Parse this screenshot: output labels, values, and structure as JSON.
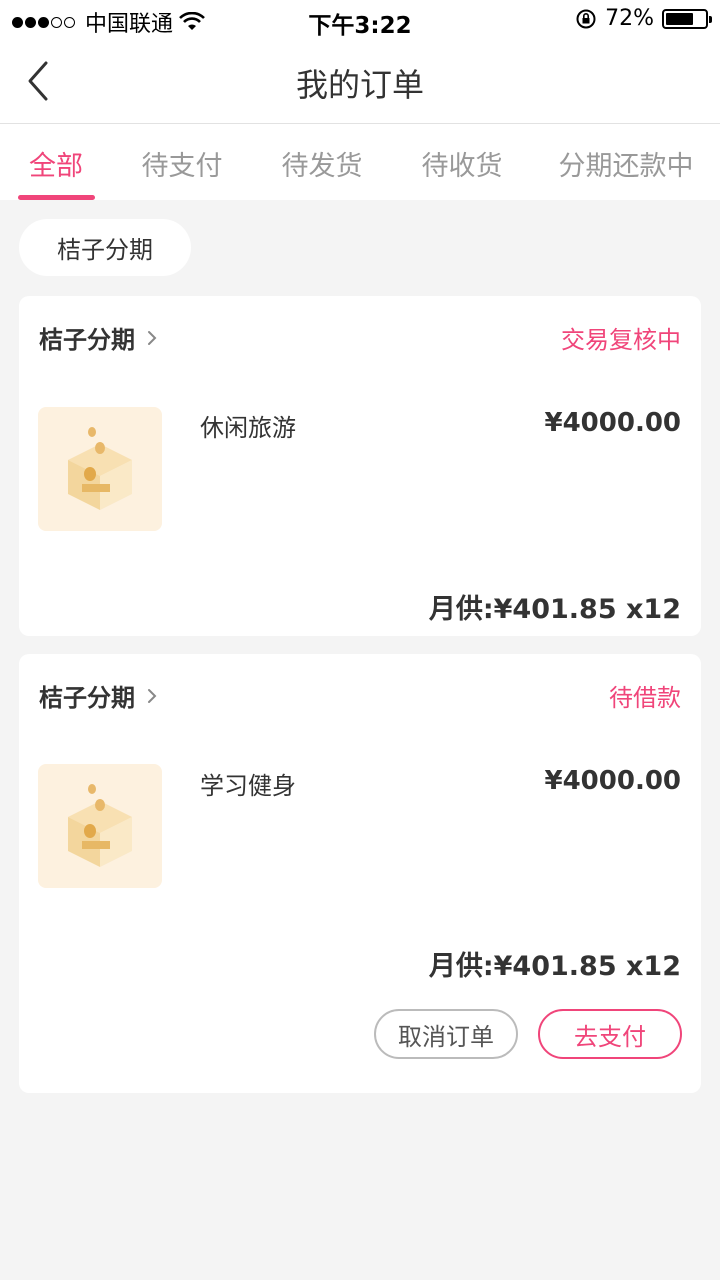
{
  "status_bar": {
    "carrier": "中国联通",
    "time": "下午3:22",
    "battery": "72%",
    "battery_level": 0.72
  },
  "nav": {
    "title": "我的订单"
  },
  "tabs": [
    {
      "label": "全部",
      "active": true
    },
    {
      "label": "待支付",
      "active": false
    },
    {
      "label": "待发货",
      "active": false
    },
    {
      "label": "待收货",
      "active": false
    },
    {
      "label": "分期还款中",
      "active": false
    }
  ],
  "filter": {
    "label": "桔子分期"
  },
  "orders": [
    {
      "merchant": "桔子分期",
      "status": "交易复核中",
      "product": "休闲旅游",
      "price": "¥4000.00",
      "monthly": "月供:¥401.85 x12"
    },
    {
      "merchant": "桔子分期",
      "status": "待借款",
      "product": "学习健身",
      "price": "¥4000.00",
      "monthly": "月供:¥401.85 x12",
      "actions": {
        "cancel": "取消订单",
        "pay": "去支付"
      }
    }
  ],
  "colors": {
    "accent": "#f0457a",
    "background": "#f4f4f4",
    "thumb_bg": "#fdf1df"
  }
}
